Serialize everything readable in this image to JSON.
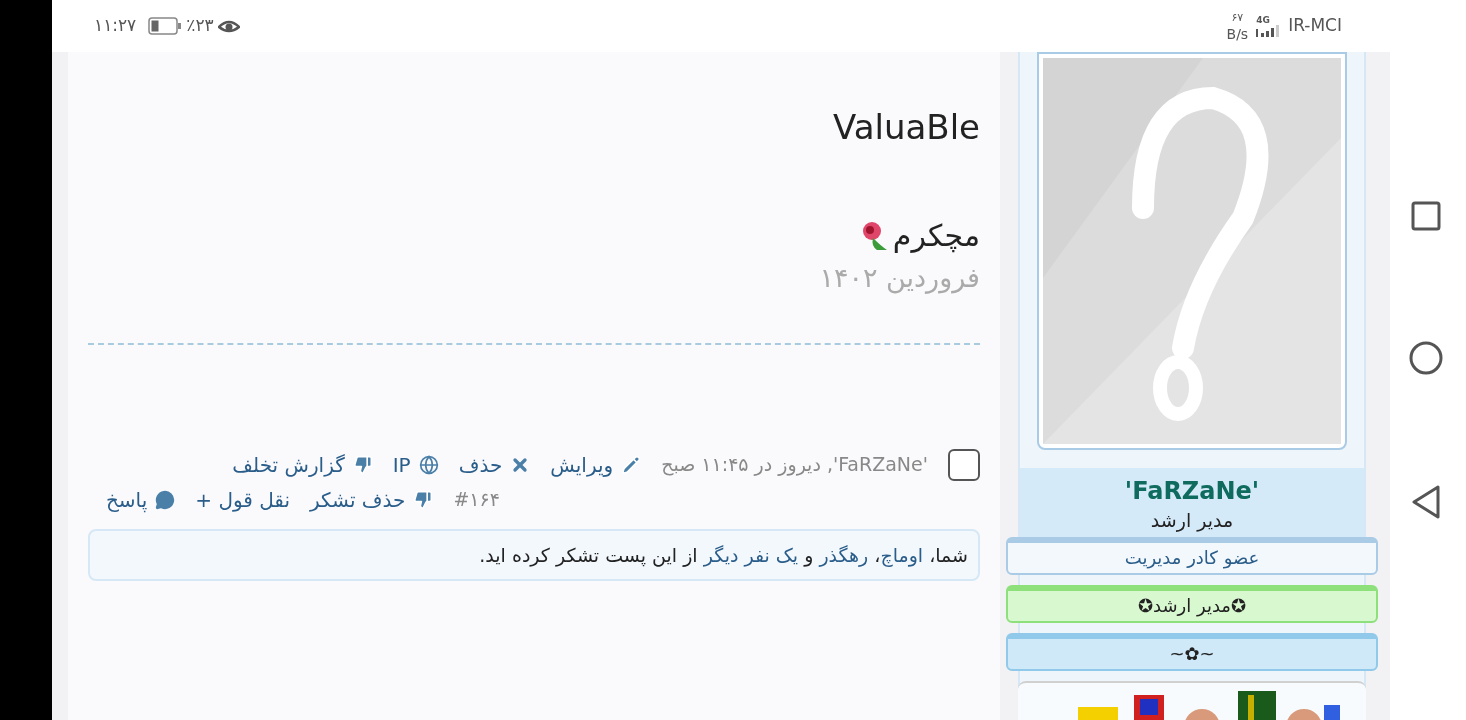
{
  "status_bar": {
    "time": "۱۱:۲۷",
    "battery": "٪۲۳",
    "net_speed": "۶۷",
    "net_unit": "B/s",
    "network": "4G",
    "carrier": "IR-MCI"
  },
  "post": {
    "body": "ValuaBle",
    "signature": "مچکرم",
    "date": "فروردین ۱۴۰۲",
    "meta": {
      "checked": false,
      "author": "'FaRZaNe'",
      "time": ", دیروز در ۱۱:۴۵ صبح",
      "post_number": "#۱۶۴",
      "actions_line1": [
        {
          "kind": "edit",
          "label": "ویرایش"
        },
        {
          "kind": "delete",
          "label": "حذف"
        },
        {
          "kind": "ip",
          "label": "IP"
        },
        {
          "kind": "report",
          "label": "گزارش تخلف"
        }
      ],
      "actions_line2": [
        {
          "kind": "unthank",
          "label": "حذف تشکر"
        },
        {
          "kind": "quote",
          "label": "نقل قول +"
        },
        {
          "kind": "reply",
          "label": "پاسخ"
        }
      ]
    },
    "thanks": [
      {
        "kind": "text",
        "text": "شما، "
      },
      {
        "kind": "link",
        "text": "اوماچ"
      },
      {
        "kind": "text",
        "text": "، "
      },
      {
        "kind": "link",
        "text": "رهگذر"
      },
      {
        "kind": "text",
        "text": " و "
      },
      {
        "kind": "link",
        "text": "یک نفر دیگر"
      },
      {
        "kind": "text",
        "text": " از این پست تشکر کرده اید."
      }
    ]
  },
  "user": {
    "name": "'FaRZaNe'",
    "title": "مدیر ارشد",
    "badges": [
      {
        "kind": "plain",
        "text": "عضو کادر مدیریت"
      },
      {
        "kind": "green",
        "text": "✪مدیر ارشد✪"
      },
      {
        "kind": "blue",
        "text": "~✿~"
      }
    ]
  }
}
